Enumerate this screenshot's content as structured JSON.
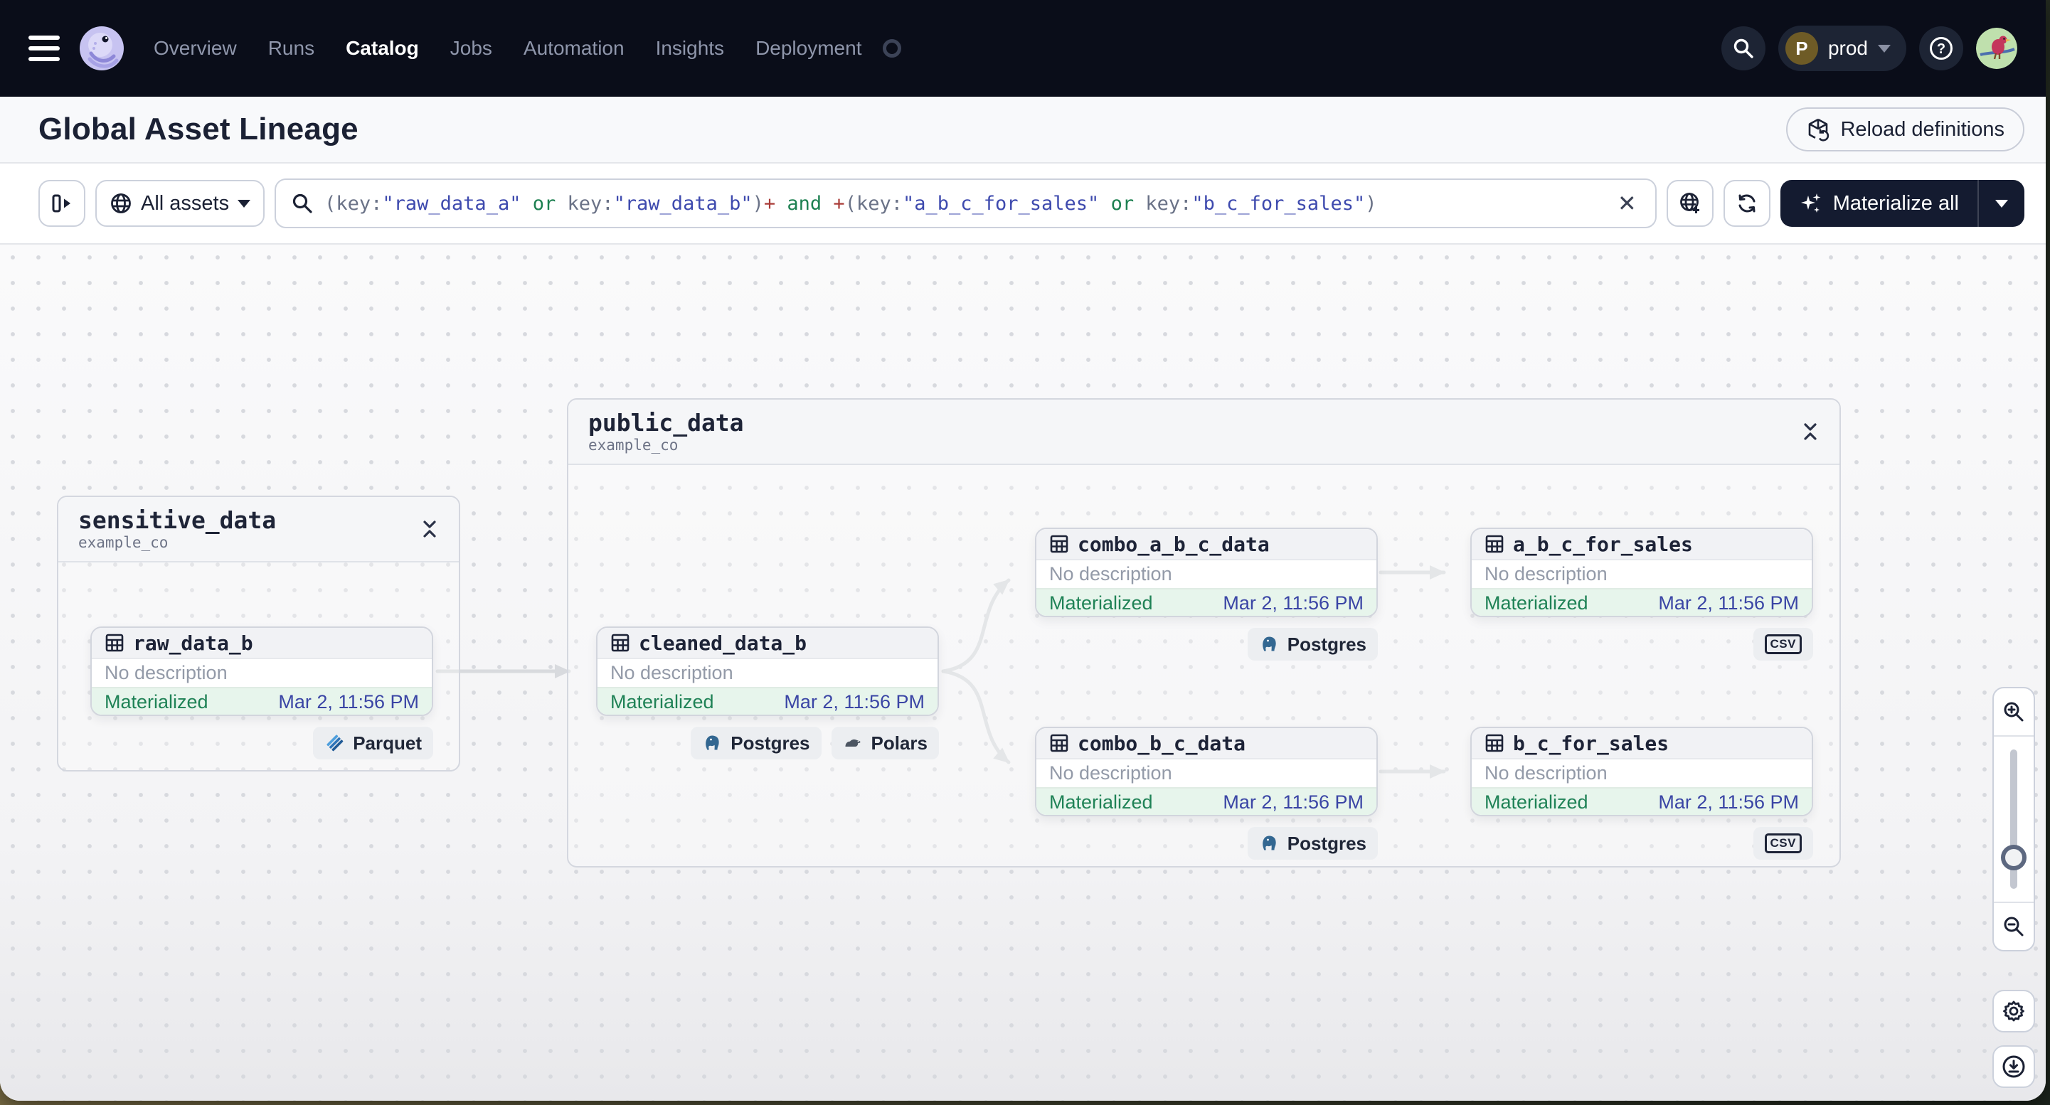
{
  "nav": {
    "items": [
      {
        "label": "Overview",
        "active": false
      },
      {
        "label": "Runs",
        "active": false
      },
      {
        "label": "Catalog",
        "active": true
      },
      {
        "label": "Jobs",
        "active": false
      },
      {
        "label": "Automation",
        "active": false
      },
      {
        "label": "Insights",
        "active": false
      },
      {
        "label": "Deployment",
        "active": false
      }
    ],
    "environment": {
      "initial": "P",
      "name": "prod"
    }
  },
  "header": {
    "title": "Global Asset Lineage",
    "reload_label": "Reload definitions"
  },
  "toolbar": {
    "scope_label": "All assets",
    "materialize_label": "Materialize all",
    "clear_label": "✕",
    "query_tokens": [
      {
        "t": "(key:"
      },
      {
        "t": "\"raw_data_a\""
      },
      {
        "t": " or "
      },
      {
        "t": "key:"
      },
      {
        "t": "\"raw_data_b\""
      },
      {
        "t": ")"
      },
      {
        "t": "+"
      },
      {
        "t": " and "
      },
      {
        "t": "+"
      },
      {
        "t": "(key:"
      },
      {
        "t": "\"a_b_c_for_sales\""
      },
      {
        "t": " or "
      },
      {
        "t": "key:"
      },
      {
        "t": "\"b_c_for_sales\""
      },
      {
        "t": ")"
      }
    ]
  },
  "graph": {
    "groups": [
      {
        "name": "sensitive_data",
        "repo": "example_co"
      },
      {
        "name": "public_data",
        "repo": "example_co"
      }
    ],
    "nodes": [
      {
        "name": "raw_data_b",
        "description": "No description",
        "status": "Materialized",
        "timestamp": "Mar 2, 11:56 PM",
        "tags": [
          "Parquet"
        ]
      },
      {
        "name": "cleaned_data_b",
        "description": "No description",
        "status": "Materialized",
        "timestamp": "Mar 2, 11:56 PM",
        "tags": [
          "Postgres",
          "Polars"
        ]
      },
      {
        "name": "combo_a_b_c_data",
        "description": "No description",
        "status": "Materialized",
        "timestamp": "Mar 2, 11:56 PM",
        "tags": [
          "Postgres"
        ]
      },
      {
        "name": "a_b_c_for_sales",
        "description": "No description",
        "status": "Materialized",
        "timestamp": "Mar 2, 11:56 PM",
        "tags": [
          "csv"
        ]
      },
      {
        "name": "combo_b_c_data",
        "description": "No description",
        "status": "Materialized",
        "timestamp": "Mar 2, 11:56 PM",
        "tags": [
          "Postgres"
        ]
      },
      {
        "name": "b_c_for_sales",
        "description": "No description",
        "status": "Materialized",
        "timestamp": "Mar 2, 11:56 PM",
        "tags": [
          "csv"
        ]
      }
    ]
  },
  "colors": {
    "nav_bg": "#0a0d19",
    "accent_navy": "#141b30",
    "materialized_green": "#1f8256",
    "status_row_bg": "#e7f5ec",
    "timestamp_indigo": "#3a45a5",
    "query_string": "#3e4aae",
    "query_operator": "#1d8051",
    "query_plus": "#a93c38",
    "edge_gray": "#d8dade"
  }
}
